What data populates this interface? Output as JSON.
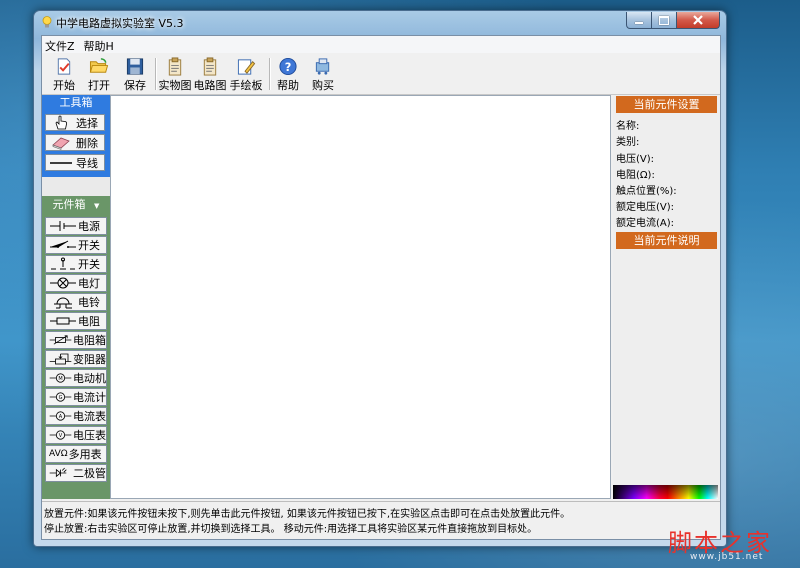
{
  "window": {
    "title": "中学电路虚拟实验室 V5.3"
  },
  "menubar": {
    "items": [
      {
        "label": "文件Z"
      },
      {
        "label": "帮助H"
      }
    ]
  },
  "toolbar": {
    "buttons": [
      {
        "label": "开始",
        "icon": "new-document-icon"
      },
      {
        "label": "打开",
        "icon": "folder-open-icon"
      },
      {
        "label": "保存",
        "icon": "floppy-disk-icon"
      },
      {
        "label": "实物图",
        "icon": "clipboard-icon"
      },
      {
        "label": "电路图",
        "icon": "clipboard-icon"
      },
      {
        "label": "手绘板",
        "icon": "pencil-board-icon"
      },
      {
        "label": "帮助",
        "icon": "help-icon"
      },
      {
        "label": "购买",
        "icon": "cart-icon"
      }
    ]
  },
  "toolbox": {
    "title": "工具箱",
    "tools": [
      {
        "label": "选择",
        "icon": "hand-pointer-icon"
      },
      {
        "label": "删除",
        "icon": "eraser-icon"
      },
      {
        "label": "导线",
        "icon": "wire-line-icon"
      }
    ]
  },
  "components": {
    "title": "元件箱",
    "dropdown_arrow": "▼",
    "items": [
      {
        "label": "电源",
        "symbol": "battery-symbol"
      },
      {
        "label": "开关",
        "symbol": "switch-symbol"
      },
      {
        "label": "开关",
        "symbol": "push-switch-symbol"
      },
      {
        "label": "电灯",
        "symbol": "lamp-symbol"
      },
      {
        "label": "电铃",
        "symbol": "bell-symbol"
      },
      {
        "label": "电阻",
        "symbol": "resistor-symbol"
      },
      {
        "label": "电阻箱",
        "symbol": "resistor-box-symbol"
      },
      {
        "label": "变阻器",
        "symbol": "rheostat-symbol"
      },
      {
        "label": "电动机",
        "symbol": "motor-symbol"
      },
      {
        "label": "电流计",
        "symbol": "galvanometer-symbol"
      },
      {
        "label": "电流表",
        "symbol": "ammeter-symbol"
      },
      {
        "label": "电压表",
        "symbol": "voltmeter-symbol"
      },
      {
        "label": "多用表",
        "prefix": "AVΩ",
        "symbol": "multimeter-symbol"
      },
      {
        "label": "二极管",
        "symbol": "diode-symbol"
      }
    ]
  },
  "properties": {
    "settings_title": "当前元件设置",
    "fields": [
      {
        "label": "名称:"
      },
      {
        "label": "类别:"
      },
      {
        "label": "电压(V):"
      },
      {
        "label": "电阻(Ω):"
      },
      {
        "label": "触点位置(%):"
      },
      {
        "label": "额定电压(V):"
      },
      {
        "label": "额定电流(A):"
      }
    ],
    "description_title": "当前元件说明"
  },
  "status": {
    "line1": "放置元件:如果该元件按钮未按下,则先单击此元件按钮, 如果该元件按钮已按下,在实验区点击即可在点击处放置此元件。",
    "line2": "停止放置:右击实验区可停止放置,并切换到选择工具。 移动元件:用选择工具将实验区某元件直接拖放到目标处。"
  },
  "watermark": {
    "text": "脚本之家",
    "url": "www.jb51.net"
  },
  "colors": {
    "toolbox_header": "#2f7be0",
    "components_header": "#6a9668",
    "property_header": "#d2691e",
    "watermark": "#e8322c"
  }
}
